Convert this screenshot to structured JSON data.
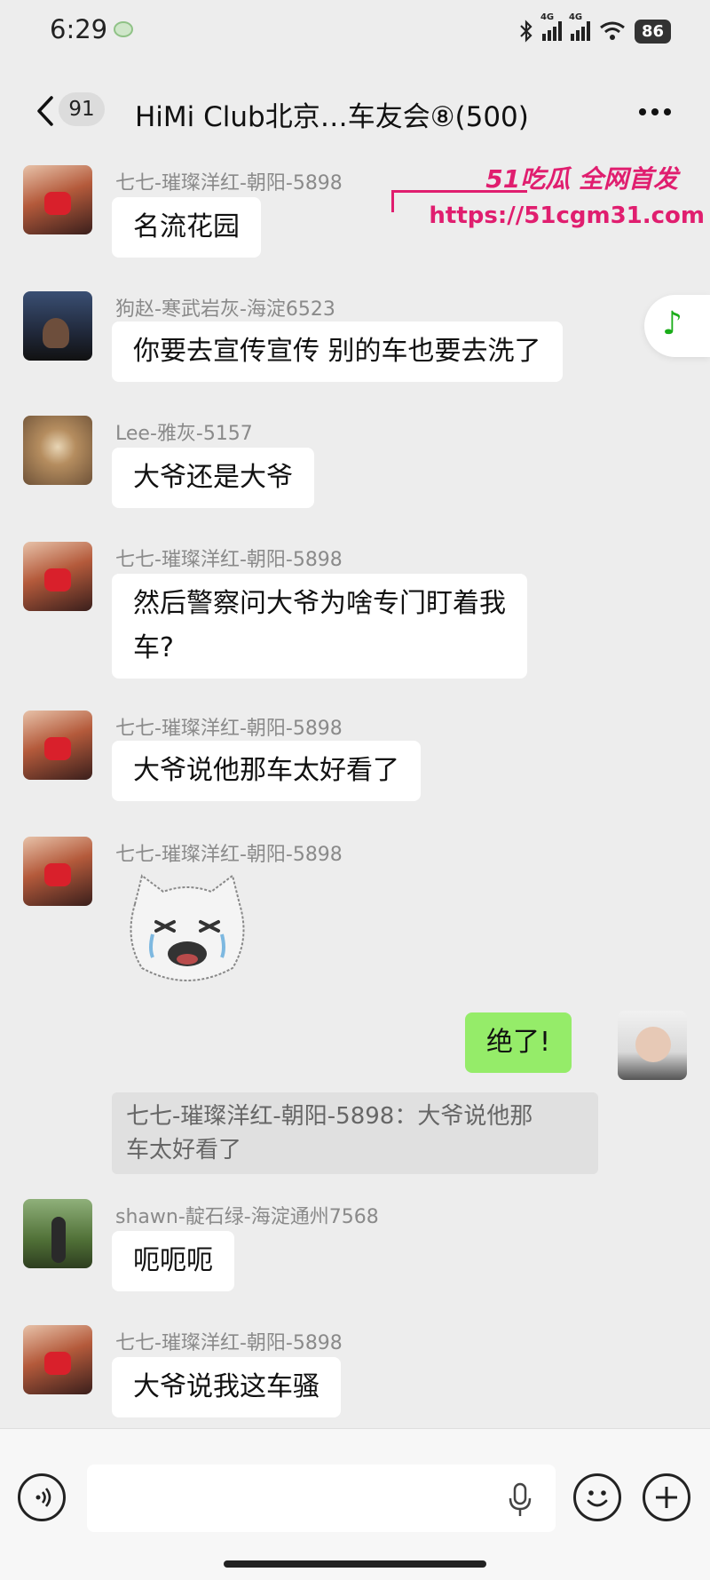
{
  "status_bar": {
    "time": "6:29",
    "network_1": "4G",
    "network_2": "4G",
    "battery": "86"
  },
  "header": {
    "unread_count": "91",
    "title": "HiMi Club北京…车友会⑧(500)"
  },
  "watermark": {
    "top": "51吃瓜 全网首发",
    "url": "https://51cgm31.com"
  },
  "messages": [
    {
      "sender": "七七-璀璨洋红-朝阳-5898",
      "text": "名流花园"
    },
    {
      "sender": "狗赵-寒武岩灰-海淀6523",
      "text": "你要去宣传宣传 别的车也要去洗了"
    },
    {
      "sender": "Lee-雅灰-5157",
      "text": "大爷还是大爷"
    },
    {
      "sender": "七七-璀璨洋红-朝阳-5898",
      "text_line1": "然后警察问大爷为啥专门盯着我",
      "text_line2": "车?"
    },
    {
      "sender": "七七-璀璨洋红-朝阳-5898",
      "text": "大爷说他那车太好看了"
    },
    {
      "sender": "七七-璀璨洋红-朝阳-5898",
      "sticker": "crying-face-sticker"
    },
    {
      "sender": "self",
      "text": "绝了!",
      "quote_line1": "七七-璀璨洋红-朝阳-5898：大爷说他那",
      "quote_line2": "车太好看了"
    },
    {
      "sender": "shawn-靛石绿-海淀通州7568",
      "text": "呃呃呃"
    },
    {
      "sender": "七七-璀璨洋红-朝阳-5898",
      "text": "大爷说我这车骚"
    }
  ],
  "colors": {
    "background": "#ededed",
    "self_bubble": "#95ec69",
    "other_bubble": "#ffffff",
    "watermark": "#e01e6f"
  }
}
